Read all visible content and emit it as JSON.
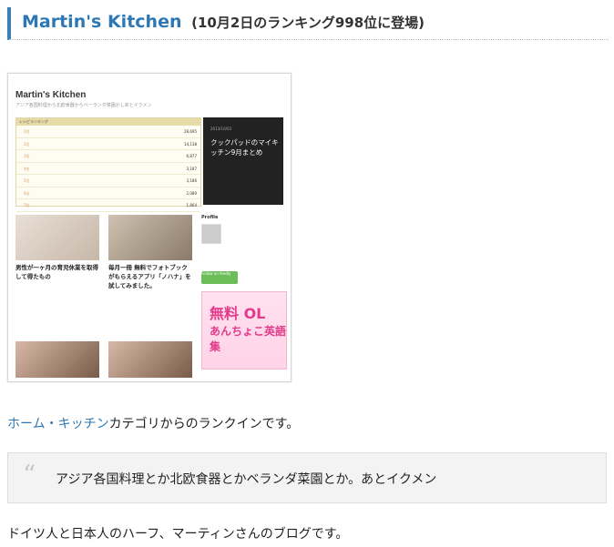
{
  "post": {
    "title": "Martin's Kitchen",
    "subtitle": "(10月2日のランキング998位に登場)",
    "category_link": "ホーム・キッチン",
    "category_suffix": "カテゴリからのランクインです。",
    "quote": "アジア各国料理とか北欧食器とかベランダ菜園とか。あとイクメン",
    "body": "ドイツ人と日本人のハーフ、マーティンさんのブログです。"
  },
  "screenshot": {
    "site_title": "Martin's Kitchen",
    "site_sub": "アジア各国料理から北欧食器からベーランダ菜園かしあとイクメン",
    "ranking_header": "レシピランキング",
    "rows": [
      {
        "n": "1位",
        "v": "28,695"
      },
      {
        "n": "2位",
        "v": "14,138"
      },
      {
        "n": "3位",
        "v": "6,877"
      },
      {
        "n": "4位",
        "v": "3,187"
      },
      {
        "n": "5位",
        "v": "3,186"
      },
      {
        "n": "6位",
        "v": "2,089"
      },
      {
        "n": "7位",
        "v": "1,864"
      }
    ],
    "dark_date": "2013/10/03",
    "dark_title": "クックパッドのマイキッチン9月まとめ",
    "card1_title": "男性が一ヶ月の育児休業を取得して得たもの",
    "card2_title": "毎月一冊 無料でフォトブックがもらえるアプリ「ノハナ」を試してみました。",
    "profile_label": "Profile",
    "ad_text1": "無料 OL",
    "ad_text2": "あんちょこ英語集",
    "follow": "Follow on feedly"
  }
}
